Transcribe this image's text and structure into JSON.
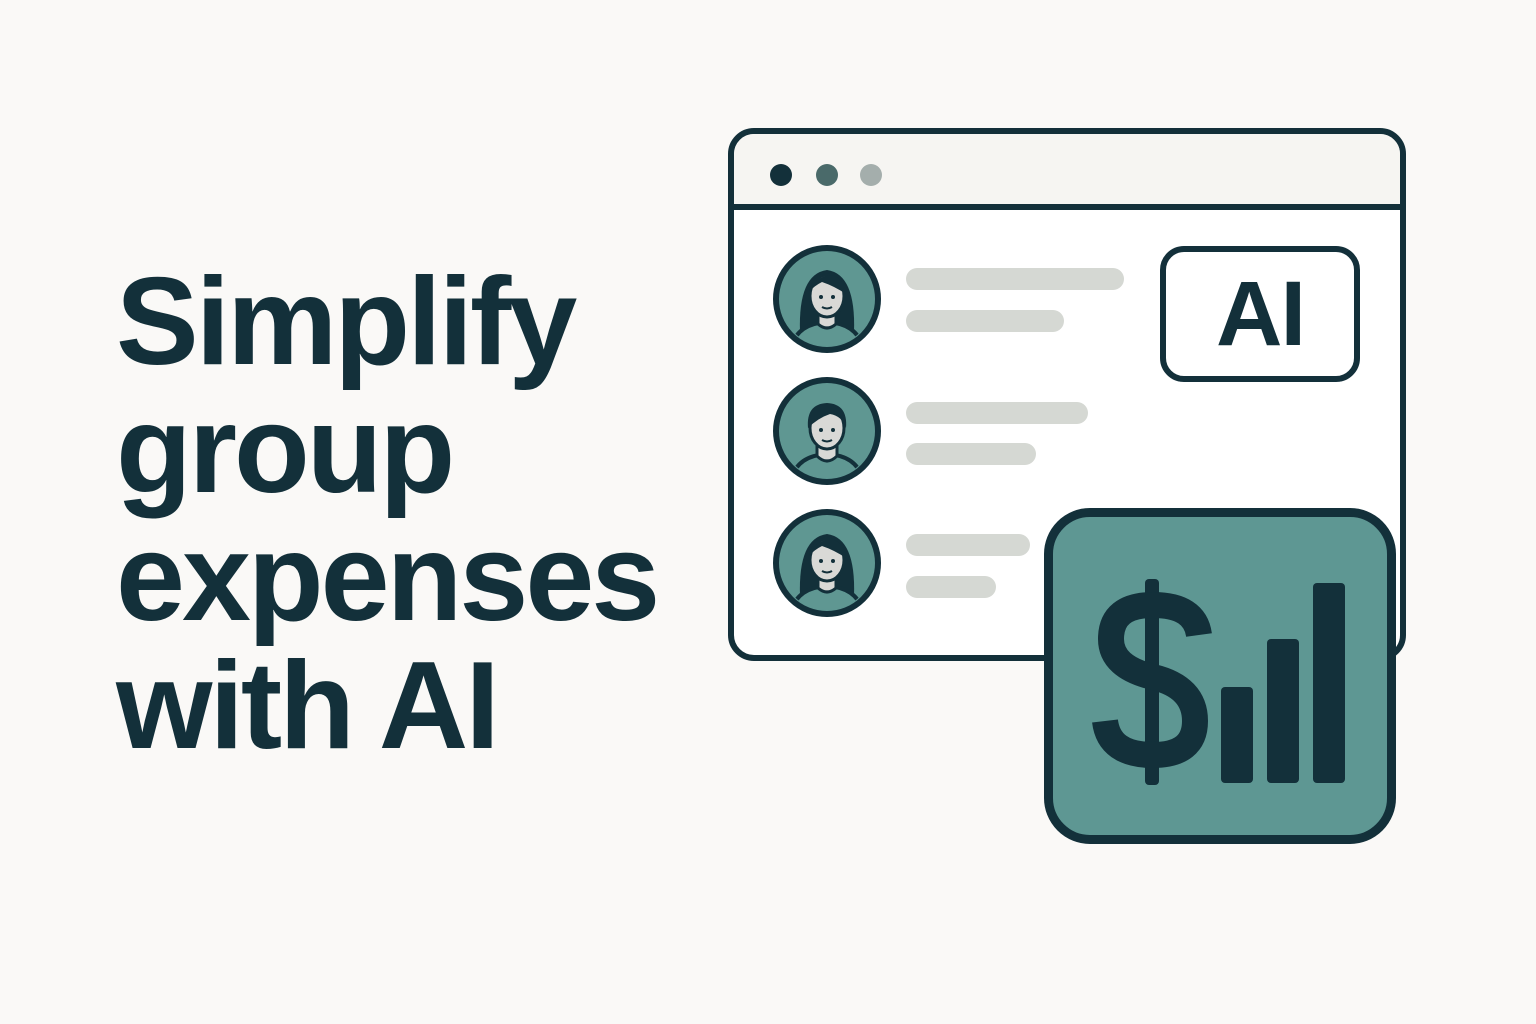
{
  "headline": {
    "lines": [
      "Simplify",
      "group",
      "expenses",
      "with AI"
    ]
  },
  "browser_window": {
    "window_controls": [
      "dark-dot",
      "mid-dot",
      "light-dot"
    ],
    "participants": [
      {
        "avatar": "woman-avatar-icon"
      },
      {
        "avatar": "man-avatar-icon"
      },
      {
        "avatar": "woman-avatar-icon"
      }
    ]
  },
  "ai_badge": {
    "label": "AI"
  },
  "finance_tile": {
    "icons": [
      "dollar-sign-icon",
      "bar-chart-icon"
    ],
    "bar_levels": [
      0.48,
      0.72,
      1.0
    ]
  },
  "colors": {
    "background": "#faf9f7",
    "ink": "#13303a",
    "accent_teal": "#5e9793",
    "avatar_teal": "#5f9792",
    "placeholder_gray": "#d5d8d3"
  }
}
